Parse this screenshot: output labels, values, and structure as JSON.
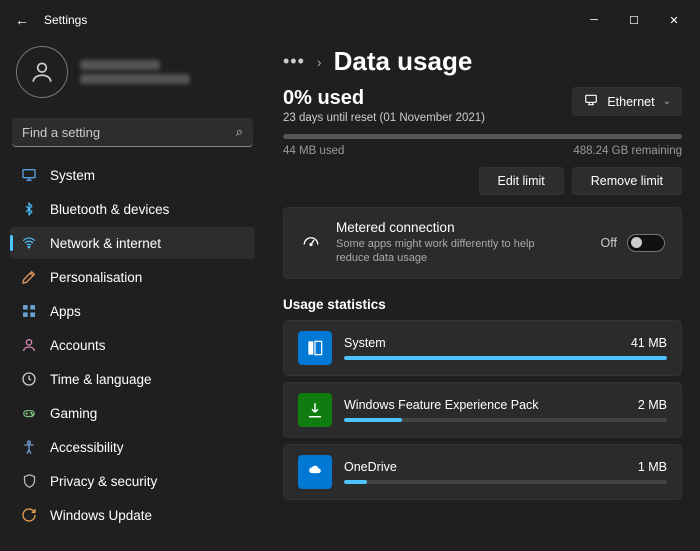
{
  "window": {
    "title": "Settings"
  },
  "search": {
    "placeholder": "Find a setting"
  },
  "nav": {
    "items": [
      {
        "label": "System"
      },
      {
        "label": "Bluetooth & devices"
      },
      {
        "label": "Network & internet"
      },
      {
        "label": "Personalisation"
      },
      {
        "label": "Apps"
      },
      {
        "label": "Accounts"
      },
      {
        "label": "Time & language"
      },
      {
        "label": "Gaming"
      },
      {
        "label": "Accessibility"
      },
      {
        "label": "Privacy & security"
      },
      {
        "label": "Windows Update"
      }
    ]
  },
  "page": {
    "title": "Data usage",
    "used_pct": "0% used",
    "reset_sub": "23 days until reset (01 November 2021)",
    "used_amt": "44 MB used",
    "remaining": "488.24 GB remaining",
    "network_btn": "Ethernet",
    "edit_btn": "Edit limit",
    "remove_btn": "Remove limit",
    "metered": {
      "title": "Metered connection",
      "desc": "Some apps might work differently to help reduce data usage",
      "state": "Off"
    },
    "stats_heading": "Usage statistics",
    "apps": [
      {
        "name": "System",
        "usage": "41 MB",
        "pct": 100
      },
      {
        "name": "Windows Feature Experience Pack",
        "usage": "2 MB",
        "pct": 18
      },
      {
        "name": "OneDrive",
        "usage": "1 MB",
        "pct": 7
      }
    ]
  }
}
